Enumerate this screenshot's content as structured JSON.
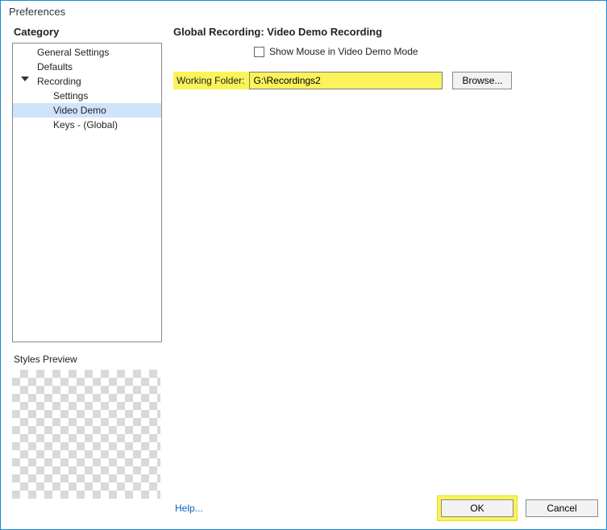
{
  "window": {
    "title": "Preferences"
  },
  "sidebar": {
    "heading": "Category",
    "items": [
      {
        "label": "General Settings"
      },
      {
        "label": "Defaults"
      },
      {
        "label": "Recording",
        "expanded": true
      },
      {
        "label": "Settings"
      },
      {
        "label": "Video Demo",
        "selected": true
      },
      {
        "label": "Keys - (Global)"
      }
    ],
    "styles_preview_label": "Styles Preview"
  },
  "main": {
    "title": "Global Recording: Video Demo Recording",
    "show_mouse_label": "Show Mouse in Video Demo Mode",
    "show_mouse_checked": false,
    "working_folder_label": "Working Folder:",
    "working_folder_value": "G:\\Recordings2",
    "browse_label": "Browse..."
  },
  "footer": {
    "help_label": "Help...",
    "ok_label": "OK",
    "cancel_label": "Cancel"
  },
  "highlight_color": "#fbf35a"
}
